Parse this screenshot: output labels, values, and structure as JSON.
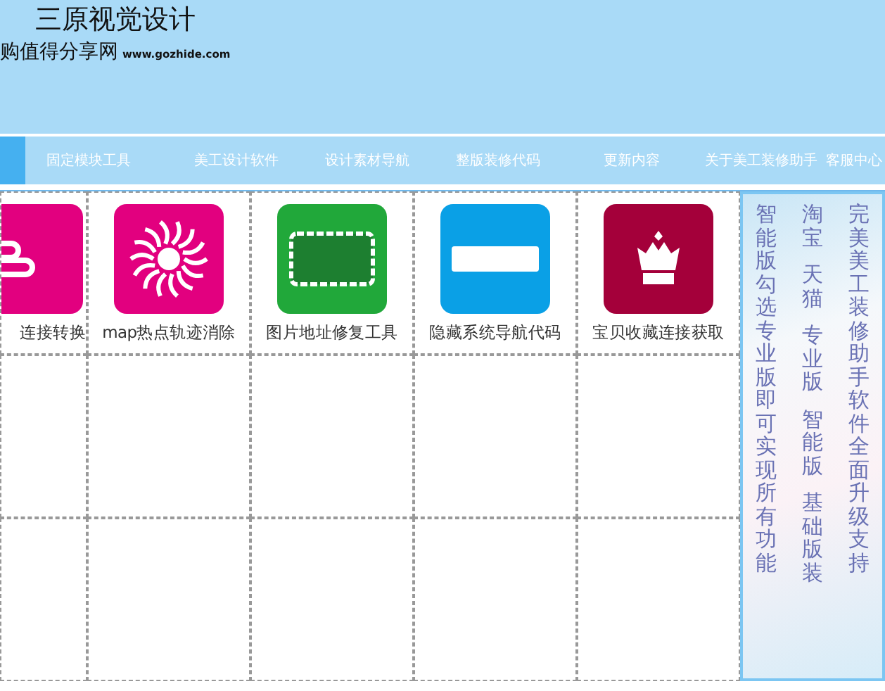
{
  "header": {
    "title": "三原视觉设计",
    "subtitle": "购值得分享网",
    "url": "www.gozhide.com"
  },
  "nav": [
    {
      "label": "固定模块工具",
      "selected": false
    },
    {
      "label": "美工设计软件",
      "selected": false
    },
    {
      "label": "设计素材导航",
      "selected": false
    },
    {
      "label": "整版装修代码",
      "selected": false
    },
    {
      "label": "更新内容",
      "selected": false
    },
    {
      "label": "关于美工装修助手",
      "selected": false
    },
    {
      "label": "客服中心",
      "selected": false
    }
  ],
  "tools": [
    {
      "label": "连接转换",
      "kind": "link",
      "color": "#e2007f"
    },
    {
      "label": "map热点轨迹消除",
      "kind": "sun",
      "color": "#e2007f"
    },
    {
      "label": "图片地址修复工具",
      "kind": "frame",
      "color": "#21a83a"
    },
    {
      "label": "隐藏系统导航代码",
      "kind": "bar",
      "color": "#0aa0e6"
    },
    {
      "label": "宝贝收藏连接获取",
      "kind": "crown",
      "color": "#a4003a"
    }
  ],
  "side_banner": {
    "columns": [
      [
        "智能版勾选专业版即可实现所有功能"
      ],
      [
        "淘宝",
        "天猫",
        "专业版",
        "智能版",
        "基础版装"
      ],
      [
        "完美美工装修助手软件全面升级支持"
      ]
    ]
  }
}
